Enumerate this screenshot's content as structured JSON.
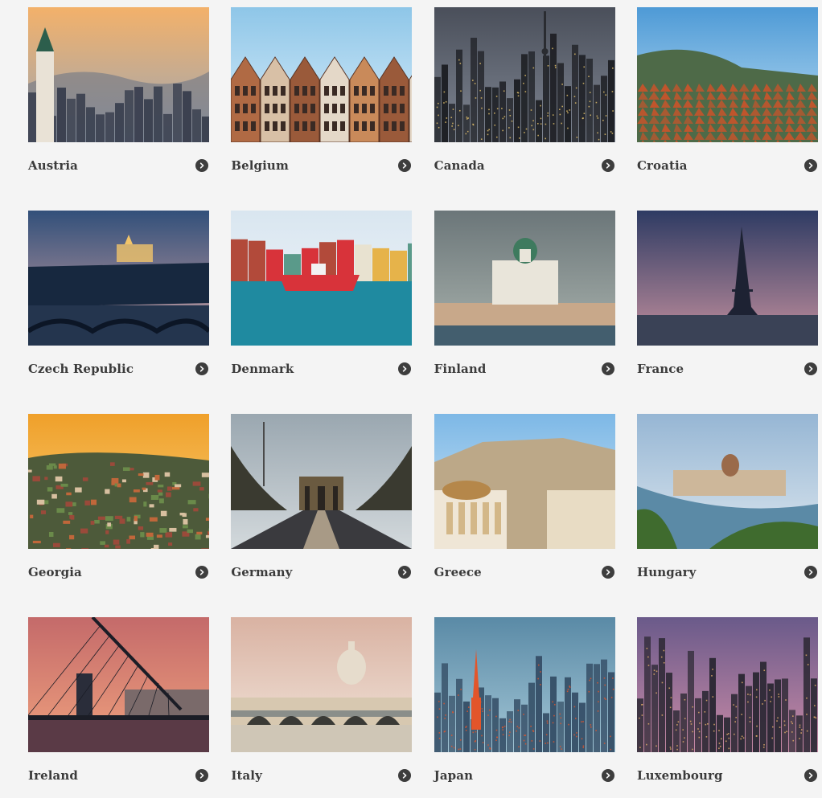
{
  "destinations": [
    {
      "name": "Austria",
      "scene": "city-dusk",
      "sky": [
        "#f3b16a",
        "#9aa6b6"
      ],
      "ground": "#3b4150",
      "accent": "#e9e2d6"
    },
    {
      "name": "Belgium",
      "scene": "gables",
      "sky": [
        "#8ec6e8",
        "#dbeefa"
      ],
      "ground": "#6a3b2a",
      "accent": "#c98a5a"
    },
    {
      "name": "Canada",
      "scene": "skyline-night",
      "sky": [
        "#4a4f5a",
        "#7f8693"
      ],
      "ground": "#1f2126",
      "accent": "#e7c46b"
    },
    {
      "name": "Croatia",
      "scene": "rooftops",
      "sky": [
        "#4e9ad6",
        "#bfe0f4"
      ],
      "ground": "#c2552c",
      "accent": "#5a7a4a"
    },
    {
      "name": "Czech Republic",
      "scene": "river-night",
      "sky": [
        "#32507a",
        "#d0a2a4"
      ],
      "ground": "#17283f",
      "accent": "#f1c46a"
    },
    {
      "name": "Denmark",
      "scene": "harbor",
      "sky": [
        "#d9e6f0",
        "#f2f6fa"
      ],
      "ground": "#1f8aa0",
      "accent": "#d8333a"
    },
    {
      "name": "Finland",
      "scene": "cathedral",
      "sky": [
        "#6b7679",
        "#a9b2ad"
      ],
      "ground": "#435e6e",
      "accent": "#e9e5da"
    },
    {
      "name": "France",
      "scene": "tower",
      "sky": [
        "#2e3b63",
        "#c4909e"
      ],
      "ground": "#3a4256",
      "accent": "#1d2233"
    },
    {
      "name": "Georgia",
      "scene": "valley-sunset",
      "sky": [
        "#f0a02a",
        "#f6d07a"
      ],
      "ground": "#6b6a4a",
      "accent": "#c0673a"
    },
    {
      "name": "Germany",
      "scene": "gate-avenue",
      "sky": [
        "#9aa7b0",
        "#d3d9dc"
      ],
      "ground": "#3a3a3e",
      "accent": "#6a5a40"
    },
    {
      "name": "Greece",
      "scene": "acropolis",
      "sky": [
        "#7db8e6",
        "#d3e8f6"
      ],
      "ground": "#d9c6a6",
      "accent": "#7a6a50"
    },
    {
      "name": "Hungary",
      "scene": "parliament",
      "sky": [
        "#96b6d4",
        "#dbe6ee"
      ],
      "ground": "#5b8aa6",
      "accent": "#3f6b2e"
    },
    {
      "name": "Ireland",
      "scene": "bridge-sunset",
      "sky": [
        "#c46a6a",
        "#f0a27e"
      ],
      "ground": "#2a2d3a",
      "accent": "#1b1d26"
    },
    {
      "name": "Italy",
      "scene": "dome",
      "sky": [
        "#d9b2a2",
        "#f2e6dc"
      ],
      "ground": "#8a8e8a",
      "accent": "#d7c8b0"
    },
    {
      "name": "Japan",
      "scene": "metro",
      "sky": [
        "#5a8aa6",
        "#a3c6d6"
      ],
      "ground": "#38526a",
      "accent": "#e2552a"
    },
    {
      "name": "Luxembourg",
      "scene": "town-night",
      "sky": [
        "#6a5a8a",
        "#c98aa6"
      ],
      "ground": "#2e2a36",
      "accent": "#e8b06a"
    }
  ]
}
